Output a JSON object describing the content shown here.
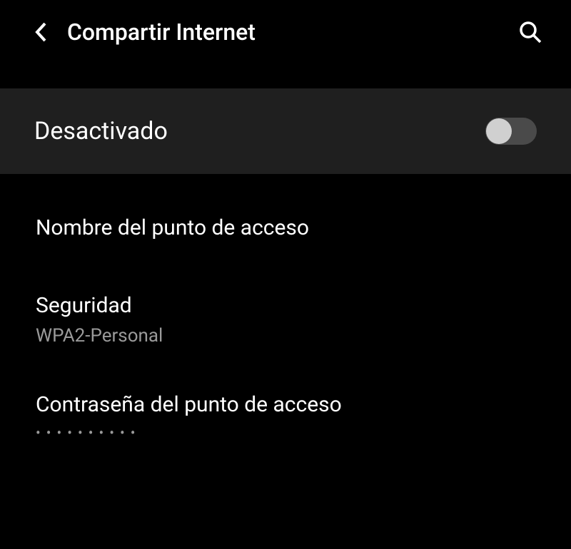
{
  "header": {
    "title": "Compartir Internet"
  },
  "toggle": {
    "label": "Desactivado",
    "state": false
  },
  "settings": {
    "hotspot_name": {
      "title": "Nombre del punto de acceso"
    },
    "security": {
      "title": "Seguridad",
      "value": "WPA2-Personal"
    },
    "password": {
      "title": "Contraseña del punto de acceso",
      "masked": "••••••••••"
    }
  }
}
